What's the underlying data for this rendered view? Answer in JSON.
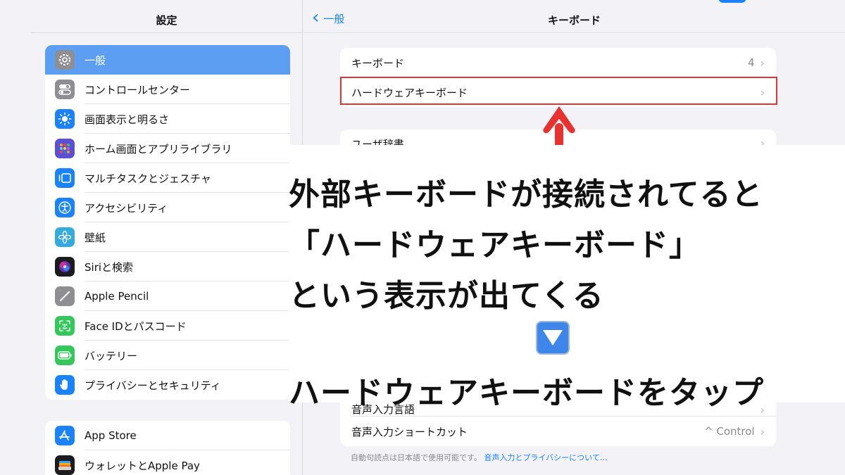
{
  "sidebar": {
    "title": "設定",
    "groups": [
      {
        "items": [
          {
            "label": "一般",
            "icon": "gear-icon",
            "color": "#8e8e93",
            "selected": true
          },
          {
            "label": "コントロールセンター",
            "icon": "toggles-icon",
            "color": "#8e8e93"
          },
          {
            "label": "画面表示と明るさ",
            "icon": "sun-icon",
            "color": "#1a82fb"
          },
          {
            "label": "ホーム画面とアプリライブラリ",
            "icon": "grid-icon",
            "color": "#5b4fd6"
          },
          {
            "label": "マルチタスクとジェスチャ",
            "icon": "multitask-icon",
            "color": "#1a82fb"
          },
          {
            "label": "アクセシビリティ",
            "icon": "accessibility-icon",
            "color": "#1a82fb"
          },
          {
            "label": "壁紙",
            "icon": "flower-icon",
            "color": "#35aadc"
          },
          {
            "label": "Siriと検索",
            "icon": "siri-icon",
            "color": "#1c1c1e"
          },
          {
            "label": "Apple Pencil",
            "icon": "pencil-icon",
            "color": "#8e8e93"
          },
          {
            "label": "Face IDとパスコード",
            "icon": "faceid-icon",
            "color": "#34c759"
          },
          {
            "label": "バッテリー",
            "icon": "battery-icon",
            "color": "#34c759"
          },
          {
            "label": "プライバシーとセキュリティ",
            "icon": "hand-icon",
            "color": "#1a82fb"
          }
        ]
      },
      {
        "items": [
          {
            "label": "App Store",
            "icon": "appstore-icon",
            "color": "#1a82fb"
          },
          {
            "label": "ウォレットとApple Pay",
            "icon": "wallet-icon",
            "color": "#1c1c1e"
          }
        ]
      }
    ]
  },
  "main": {
    "back_label": "一般",
    "title": "キーボード",
    "rows_top": [
      {
        "label": "キーボード",
        "value": "4"
      },
      {
        "label": "ハードウェアキーボード",
        "value": ""
      }
    ],
    "row_clipped_label": "ユーザ辞書",
    "rows_bottom": [
      {
        "label": "音声入力言語",
        "value": ""
      },
      {
        "label": "音声入力ショートカット",
        "value": "^ Control"
      }
    ],
    "footnote": "自動句読点は日本語で使用可能です。",
    "footnote_link": "音声入力とプライバシーについて…"
  },
  "overlay": {
    "line1": "外部キーボードが接続されてると",
    "line2": "「ハードウェアキーボード」",
    "line3": "という表示が出てくる",
    "line4": "ハードウェアキーボードをタップ",
    "arrow_color": "#e8322f",
    "highlight_color": "#e8322f"
  }
}
